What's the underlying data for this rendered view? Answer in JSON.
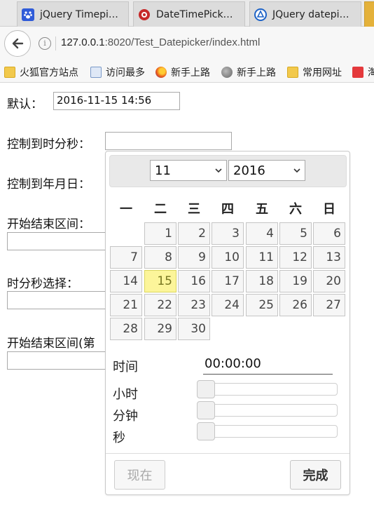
{
  "browser": {
    "tabs": [
      {
        "label": "jQuery Timepi…",
        "icon": "baidu-paw-icon"
      },
      {
        "label": "DateTimePick…",
        "icon": "red-circle-icon"
      },
      {
        "label": "JQuery datepi…",
        "icon": "blue-logo-icon"
      }
    ],
    "url_host": "127.0.0.1",
    "url_rest": ":8020/Test_Datepicker/index.html",
    "bookmarks": [
      {
        "label": "火狐官方站点",
        "icon": "folder-icon"
      },
      {
        "label": "访问最多",
        "icon": "bookmark-page-icon"
      },
      {
        "label": "新手上路",
        "icon": "firefox-icon"
      },
      {
        "label": "新手上路",
        "icon": "globe-icon"
      },
      {
        "label": "常用网址",
        "icon": "folder-icon"
      },
      {
        "label": "淘",
        "icon": "taobao-icon"
      }
    ]
  },
  "form": {
    "default_label": "默认：",
    "default_value": "2016-11-15 14:56",
    "hms_label": "控制到时分秒：",
    "ymd_label": "控制到年月日：",
    "range_label": "开始结束区间：",
    "time_select_label": "时分秒选择：",
    "range2_label": "开始结束区间(第"
  },
  "picker": {
    "month": "11",
    "year": "2016",
    "weekdays": [
      "一",
      "二",
      "三",
      "四",
      "五",
      "六",
      "日"
    ],
    "days": [
      [
        "",
        "1",
        "2",
        "3",
        "4",
        "5",
        "6"
      ],
      [
        "7",
        "8",
        "9",
        "10",
        "11",
        "12",
        "13"
      ],
      [
        "14",
        "15",
        "16",
        "17",
        "18",
        "19",
        "20"
      ],
      [
        "21",
        "22",
        "23",
        "24",
        "25",
        "26",
        "27"
      ],
      [
        "28",
        "29",
        "30",
        "",
        "",
        "",
        ""
      ]
    ],
    "today": "15",
    "time_label": "时间",
    "time_value": "00:00:00",
    "hour_label": "小时",
    "minute_label": "分钟",
    "second_label": "秒",
    "now_label": "现在",
    "done_label": "完成",
    "hour_level": 0,
    "minute_level": 0,
    "second_level": 0
  }
}
